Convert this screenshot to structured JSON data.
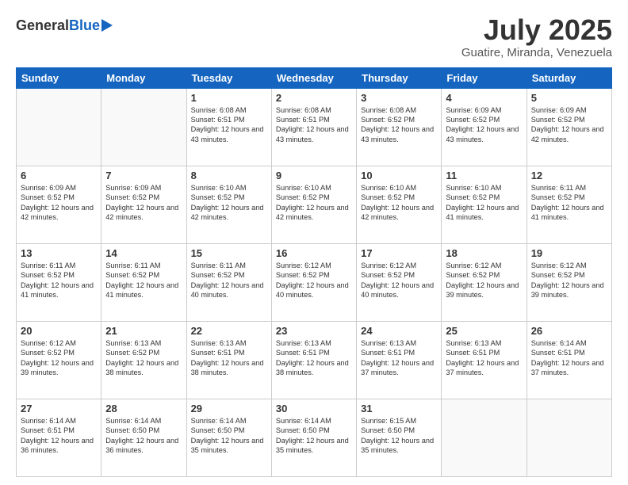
{
  "header": {
    "logo_general": "General",
    "logo_blue": "Blue",
    "title": "July 2025",
    "location": "Guatire, Miranda, Venezuela"
  },
  "days_of_week": [
    "Sunday",
    "Monday",
    "Tuesday",
    "Wednesday",
    "Thursday",
    "Friday",
    "Saturday"
  ],
  "weeks": [
    [
      {
        "num": "",
        "detail": ""
      },
      {
        "num": "",
        "detail": ""
      },
      {
        "num": "1",
        "detail": "Sunrise: 6:08 AM\nSunset: 6:51 PM\nDaylight: 12 hours\nand 43 minutes."
      },
      {
        "num": "2",
        "detail": "Sunrise: 6:08 AM\nSunset: 6:51 PM\nDaylight: 12 hours\nand 43 minutes."
      },
      {
        "num": "3",
        "detail": "Sunrise: 6:08 AM\nSunset: 6:52 PM\nDaylight: 12 hours\nand 43 minutes."
      },
      {
        "num": "4",
        "detail": "Sunrise: 6:09 AM\nSunset: 6:52 PM\nDaylight: 12 hours\nand 43 minutes."
      },
      {
        "num": "5",
        "detail": "Sunrise: 6:09 AM\nSunset: 6:52 PM\nDaylight: 12 hours\nand 42 minutes."
      }
    ],
    [
      {
        "num": "6",
        "detail": "Sunrise: 6:09 AM\nSunset: 6:52 PM\nDaylight: 12 hours\nand 42 minutes."
      },
      {
        "num": "7",
        "detail": "Sunrise: 6:09 AM\nSunset: 6:52 PM\nDaylight: 12 hours\nand 42 minutes."
      },
      {
        "num": "8",
        "detail": "Sunrise: 6:10 AM\nSunset: 6:52 PM\nDaylight: 12 hours\nand 42 minutes."
      },
      {
        "num": "9",
        "detail": "Sunrise: 6:10 AM\nSunset: 6:52 PM\nDaylight: 12 hours\nand 42 minutes."
      },
      {
        "num": "10",
        "detail": "Sunrise: 6:10 AM\nSunset: 6:52 PM\nDaylight: 12 hours\nand 42 minutes."
      },
      {
        "num": "11",
        "detail": "Sunrise: 6:10 AM\nSunset: 6:52 PM\nDaylight: 12 hours\nand 41 minutes."
      },
      {
        "num": "12",
        "detail": "Sunrise: 6:11 AM\nSunset: 6:52 PM\nDaylight: 12 hours\nand 41 minutes."
      }
    ],
    [
      {
        "num": "13",
        "detail": "Sunrise: 6:11 AM\nSunset: 6:52 PM\nDaylight: 12 hours\nand 41 minutes."
      },
      {
        "num": "14",
        "detail": "Sunrise: 6:11 AM\nSunset: 6:52 PM\nDaylight: 12 hours\nand 41 minutes."
      },
      {
        "num": "15",
        "detail": "Sunrise: 6:11 AM\nSunset: 6:52 PM\nDaylight: 12 hours\nand 40 minutes."
      },
      {
        "num": "16",
        "detail": "Sunrise: 6:12 AM\nSunset: 6:52 PM\nDaylight: 12 hours\nand 40 minutes."
      },
      {
        "num": "17",
        "detail": "Sunrise: 6:12 AM\nSunset: 6:52 PM\nDaylight: 12 hours\nand 40 minutes."
      },
      {
        "num": "18",
        "detail": "Sunrise: 6:12 AM\nSunset: 6:52 PM\nDaylight: 12 hours\nand 39 minutes."
      },
      {
        "num": "19",
        "detail": "Sunrise: 6:12 AM\nSunset: 6:52 PM\nDaylight: 12 hours\nand 39 minutes."
      }
    ],
    [
      {
        "num": "20",
        "detail": "Sunrise: 6:12 AM\nSunset: 6:52 PM\nDaylight: 12 hours\nand 39 minutes."
      },
      {
        "num": "21",
        "detail": "Sunrise: 6:13 AM\nSunset: 6:52 PM\nDaylight: 12 hours\nand 38 minutes."
      },
      {
        "num": "22",
        "detail": "Sunrise: 6:13 AM\nSunset: 6:51 PM\nDaylight: 12 hours\nand 38 minutes."
      },
      {
        "num": "23",
        "detail": "Sunrise: 6:13 AM\nSunset: 6:51 PM\nDaylight: 12 hours\nand 38 minutes."
      },
      {
        "num": "24",
        "detail": "Sunrise: 6:13 AM\nSunset: 6:51 PM\nDaylight: 12 hours\nand 37 minutes."
      },
      {
        "num": "25",
        "detail": "Sunrise: 6:13 AM\nSunset: 6:51 PM\nDaylight: 12 hours\nand 37 minutes."
      },
      {
        "num": "26",
        "detail": "Sunrise: 6:14 AM\nSunset: 6:51 PM\nDaylight: 12 hours\nand 37 minutes."
      }
    ],
    [
      {
        "num": "27",
        "detail": "Sunrise: 6:14 AM\nSunset: 6:51 PM\nDaylight: 12 hours\nand 36 minutes."
      },
      {
        "num": "28",
        "detail": "Sunrise: 6:14 AM\nSunset: 6:50 PM\nDaylight: 12 hours\nand 36 minutes."
      },
      {
        "num": "29",
        "detail": "Sunrise: 6:14 AM\nSunset: 6:50 PM\nDaylight: 12 hours\nand 35 minutes."
      },
      {
        "num": "30",
        "detail": "Sunrise: 6:14 AM\nSunset: 6:50 PM\nDaylight: 12 hours\nand 35 minutes."
      },
      {
        "num": "31",
        "detail": "Sunrise: 6:15 AM\nSunset: 6:50 PM\nDaylight: 12 hours\nand 35 minutes."
      },
      {
        "num": "",
        "detail": ""
      },
      {
        "num": "",
        "detail": ""
      }
    ]
  ]
}
